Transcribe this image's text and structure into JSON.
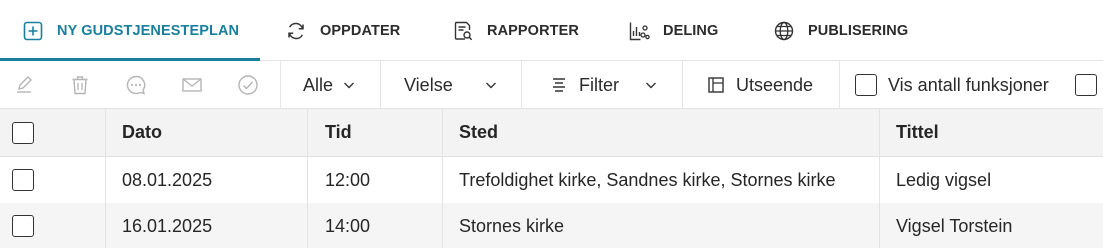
{
  "tabs": [
    {
      "label": "NY GUDSTJENESTEPLAN",
      "icon": "plus-square-icon",
      "active": true
    },
    {
      "label": "OPPDATER",
      "icon": "refresh-icon",
      "active": false
    },
    {
      "label": "RAPPORTER",
      "icon": "report-search-icon",
      "active": false
    },
    {
      "label": "DELING",
      "icon": "share-chart-icon",
      "active": false
    },
    {
      "label": "PUBLISERING",
      "icon": "globe-icon",
      "active": false
    }
  ],
  "toolbar": {
    "actions": [
      "edit-icon",
      "delete-icon",
      "comment-icon",
      "mail-icon",
      "check-circle-icon"
    ],
    "scope_select": "Alle",
    "type_select": "Vielse",
    "filter_label": "Filter",
    "appearance_label": "Utseende",
    "show_count_label": "Vis antall funksjoner"
  },
  "table": {
    "columns": [
      "Dato",
      "Tid",
      "Sted",
      "Tittel"
    ],
    "rows": [
      {
        "dato": "08.01.2025",
        "tid": "12:00",
        "sted": "Trefoldighet kirke, Sandnes kirke, Stornes kirke",
        "tittel": "Ledig vigsel"
      },
      {
        "dato": "16.01.2025",
        "tid": "14:00",
        "sted": "Stornes kirke",
        "tittel": "Vigsel Torstein"
      }
    ]
  },
  "colors": {
    "accent": "#1a7f9c",
    "header_bg": "#f3f3f3",
    "alt_row_bg": "#f5f5f5"
  }
}
